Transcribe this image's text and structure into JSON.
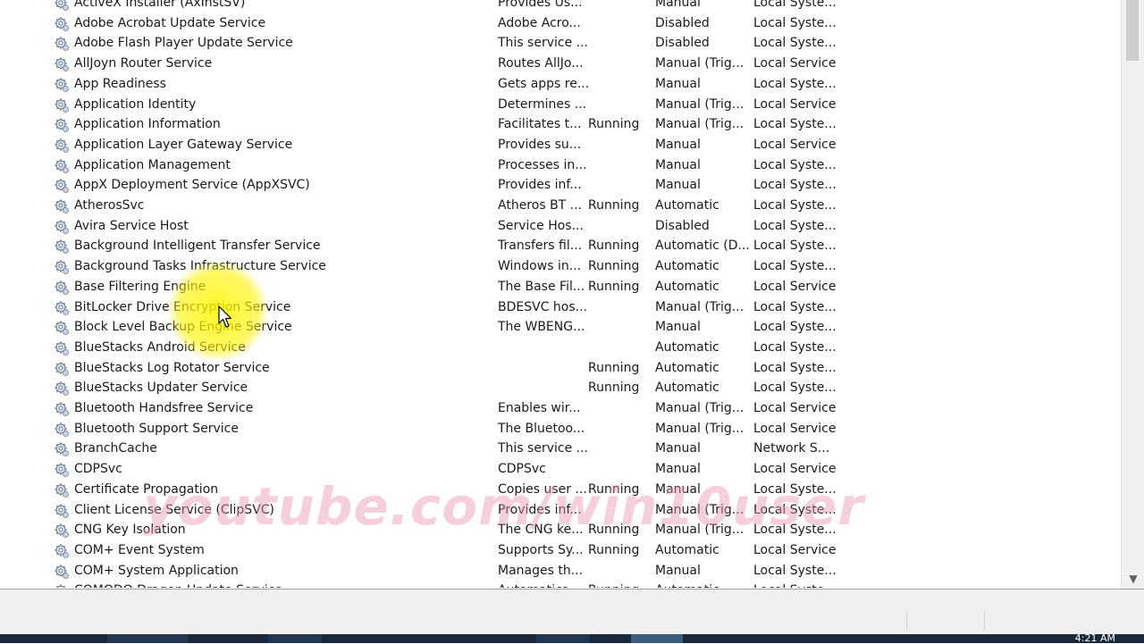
{
  "services": [
    {
      "name": "ActiveX Installer (AxInstSV)",
      "description": "Provides Us...",
      "status": "",
      "startup": "Manual",
      "logon": "Local Syste..."
    },
    {
      "name": "Adobe Acrobat Update Service",
      "description": "Adobe Acro...",
      "status": "",
      "startup": "Disabled",
      "logon": "Local Syste..."
    },
    {
      "name": "Adobe Flash Player Update Service",
      "description": "This service ...",
      "status": "",
      "startup": "Disabled",
      "logon": "Local Syste..."
    },
    {
      "name": "AllJoyn Router Service",
      "description": "Routes AllJo...",
      "status": "",
      "startup": "Manual (Trig...",
      "logon": "Local Service"
    },
    {
      "name": "App Readiness",
      "description": "Gets apps re...",
      "status": "",
      "startup": "Manual",
      "logon": "Local Syste..."
    },
    {
      "name": "Application Identity",
      "description": "Determines ...",
      "status": "",
      "startup": "Manual (Trig...",
      "logon": "Local Service"
    },
    {
      "name": "Application Information",
      "description": "Facilitates t...",
      "status": "Running",
      "startup": "Manual (Trig...",
      "logon": "Local Syste..."
    },
    {
      "name": "Application Layer Gateway Service",
      "description": "Provides su...",
      "status": "",
      "startup": "Manual",
      "logon": "Local Service"
    },
    {
      "name": "Application Management",
      "description": "Processes in...",
      "status": "",
      "startup": "Manual",
      "logon": "Local Syste..."
    },
    {
      "name": "AppX Deployment Service (AppXSVC)",
      "description": "Provides inf...",
      "status": "",
      "startup": "Manual",
      "logon": "Local Syste..."
    },
    {
      "name": "AtherosSvc",
      "description": "Atheros BT ...",
      "status": "Running",
      "startup": "Automatic",
      "logon": "Local Syste..."
    },
    {
      "name": "Avira Service Host",
      "description": "Service Hos...",
      "status": "",
      "startup": "Disabled",
      "logon": "Local Syste..."
    },
    {
      "name": "Background Intelligent Transfer Service",
      "description": "Transfers fil...",
      "status": "Running",
      "startup": "Automatic (D...",
      "logon": "Local Syste..."
    },
    {
      "name": "Background Tasks Infrastructure Service",
      "description": "Windows in...",
      "status": "Running",
      "startup": "Automatic",
      "logon": "Local Syste..."
    },
    {
      "name": "Base Filtering Engine",
      "description": "The Base Fil...",
      "status": "Running",
      "startup": "Automatic",
      "logon": "Local Service"
    },
    {
      "name": "BitLocker Drive Encryption Service",
      "description": "BDESVC hos...",
      "status": "",
      "startup": "Manual (Trig...",
      "logon": "Local Syste..."
    },
    {
      "name": "Block Level Backup Engine Service",
      "description": "The WBENG...",
      "status": "",
      "startup": "Manual",
      "logon": "Local Syste..."
    },
    {
      "name": "BlueStacks Android Service",
      "description": "",
      "status": "",
      "startup": "Automatic",
      "logon": "Local Syste..."
    },
    {
      "name": "BlueStacks Log Rotator Service",
      "description": "",
      "status": "Running",
      "startup": "Automatic",
      "logon": "Local Syste..."
    },
    {
      "name": "BlueStacks Updater Service",
      "description": "",
      "status": "Running",
      "startup": "Automatic",
      "logon": "Local Syste..."
    },
    {
      "name": "Bluetooth Handsfree Service",
      "description": "Enables wir...",
      "status": "",
      "startup": "Manual (Trig...",
      "logon": "Local Service"
    },
    {
      "name": "Bluetooth Support Service",
      "description": "The Bluetoo...",
      "status": "",
      "startup": "Manual (Trig...",
      "logon": "Local Service"
    },
    {
      "name": "BranchCache",
      "description": "This service ...",
      "status": "",
      "startup": "Manual",
      "logon": "Network S..."
    },
    {
      "name": "CDPSvc",
      "description": "CDPSvc",
      "status": "",
      "startup": "Manual",
      "logon": "Local Service"
    },
    {
      "name": "Certificate Propagation",
      "description": "Copies user ...",
      "status": "Running",
      "startup": "Manual",
      "logon": "Local Syste..."
    },
    {
      "name": "Client License Service (ClipSVC)",
      "description": "Provides inf...",
      "status": "",
      "startup": "Manual (Trig...",
      "logon": "Local Syste..."
    },
    {
      "name": "CNG Key Isolation",
      "description": "The CNG ke...",
      "status": "Running",
      "startup": "Manual (Trig...",
      "logon": "Local Syste..."
    },
    {
      "name": "COM+ Event System",
      "description": "Supports Sy...",
      "status": "Running",
      "startup": "Automatic",
      "logon": "Local Service"
    },
    {
      "name": "COM+ System Application",
      "description": "Manages th...",
      "status": "",
      "startup": "Manual",
      "logon": "Local Syste..."
    },
    {
      "name": "COMODO Dragon Update Service",
      "description": "Automatica...",
      "status": "Running",
      "startup": "Automatic",
      "logon": "Local Syste..."
    }
  ],
  "scrollbar": {
    "up_arrow": "▲",
    "down_arrow": "▼"
  },
  "watermark": "youtube.com/win10user",
  "taskbar": {
    "clock": "4:21 AM"
  },
  "icons": {
    "service": "gear-icon",
    "cursor": "mouse-pointer-icon"
  }
}
